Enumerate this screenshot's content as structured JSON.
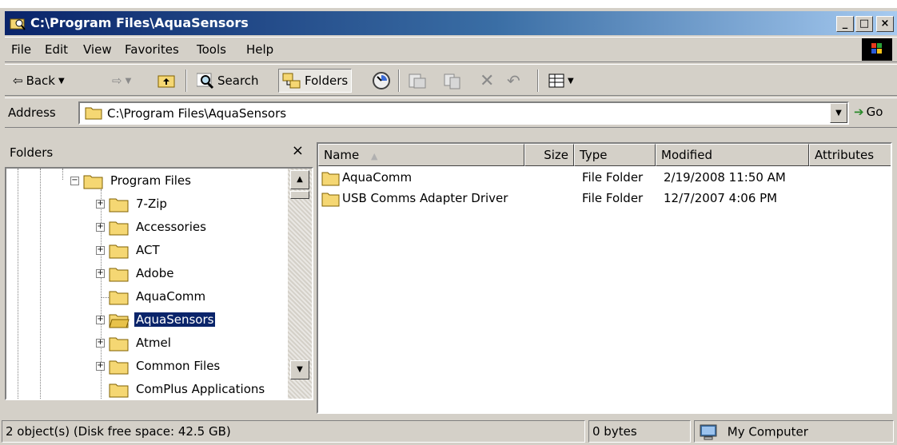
{
  "window": {
    "title": "C:\\Program Files\\AquaSensors",
    "minimize": "_",
    "maximize": "□",
    "close": "×"
  },
  "menu": [
    "File",
    "Edit",
    "View",
    "Favorites",
    "Tools",
    "Help"
  ],
  "toolbar": {
    "back": "Back",
    "search": "Search",
    "folders": "Folders"
  },
  "address": {
    "label": "Address",
    "value": "C:\\Program Files\\AquaSensors",
    "go": "Go"
  },
  "folders_pane": {
    "title": "Folders",
    "close": "×",
    "tree": [
      {
        "label": "Program Files",
        "expanded": true
      },
      {
        "label": "7-Zip"
      },
      {
        "label": "Accessories"
      },
      {
        "label": "ACT"
      },
      {
        "label": "Adobe"
      },
      {
        "label": "AquaComm"
      },
      {
        "label": "AquaSensors",
        "selected": true
      },
      {
        "label": "Atmel"
      },
      {
        "label": "Common Files"
      },
      {
        "label": "ComPlus Applications"
      }
    ]
  },
  "file_list": {
    "columns": [
      "Name",
      "Size",
      "Type",
      "Modified",
      "Attributes"
    ],
    "rows": [
      {
        "name": "AquaComm",
        "size": "",
        "type": "File Folder",
        "modified": "2/19/2008 11:50 AM",
        "attributes": ""
      },
      {
        "name": "USB Comms Adapter Driver",
        "size": "",
        "type": "File Folder",
        "modified": "12/7/2007 4:06 PM",
        "attributes": ""
      }
    ]
  },
  "status": {
    "objects": "2 object(s) (Disk free space: 42.5 GB)",
    "size": "0 bytes",
    "zone": "My Computer"
  },
  "colors": {
    "title_start": "#0a246a",
    "title_end": "#a6caf0",
    "face": "#d4d0c8",
    "folder": "#f5d773",
    "selection": "#0a246a"
  }
}
